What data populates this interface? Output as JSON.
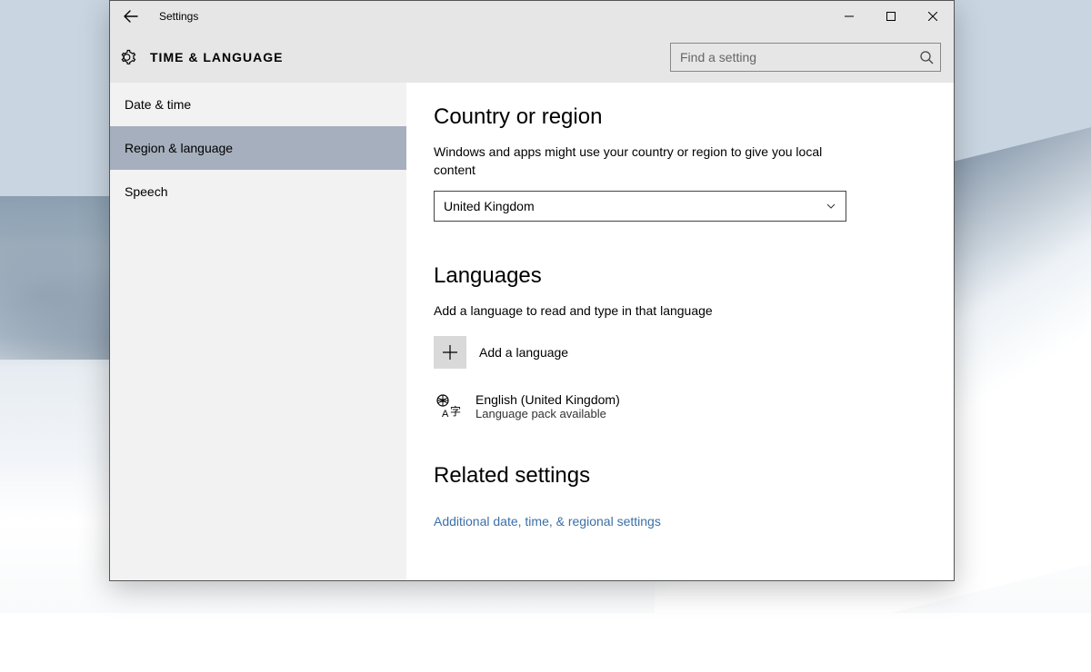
{
  "window": {
    "title": "Settings"
  },
  "header": {
    "title": "TIME & LANGUAGE",
    "search_placeholder": "Find a setting"
  },
  "sidebar": {
    "items": [
      {
        "label": "Date & time"
      },
      {
        "label": "Region & language"
      },
      {
        "label": "Speech"
      }
    ],
    "selected_index": 1
  },
  "content": {
    "region": {
      "heading": "Country or region",
      "description": "Windows and apps might use your country or region to give you local content",
      "selected": "United Kingdom"
    },
    "languages": {
      "heading": "Languages",
      "description": "Add a language to read and type in that language",
      "add_label": "Add a language",
      "items": [
        {
          "name": "English (United Kingdom)",
          "status": "Language pack available"
        }
      ]
    },
    "related": {
      "heading": "Related settings",
      "link": "Additional date, time, & regional settings"
    }
  }
}
